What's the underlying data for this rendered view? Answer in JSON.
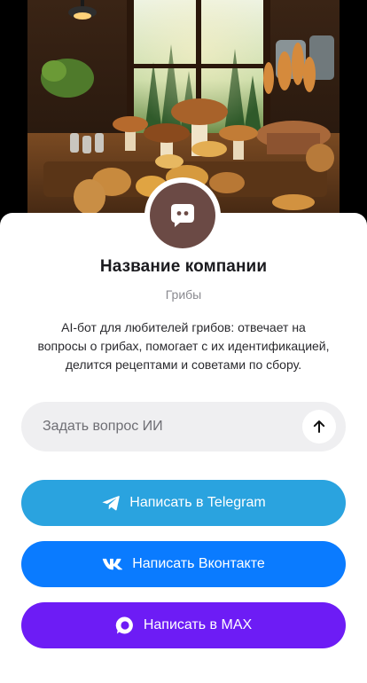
{
  "company": {
    "name": "Название компании",
    "category": "Грибы",
    "description": "AI-бот для любителей грибов: отвечает на вопросы о грибах, помогает с их идентификацией, делится рецептами и советами по сбору.",
    "avatar_icon": "chat-bubble-icon",
    "avatar_color": "#6b4a45"
  },
  "ask": {
    "placeholder": "Задать вопрос ИИ",
    "send_icon": "arrow-up-icon"
  },
  "buttons": {
    "telegram": {
      "label": "Написать в Telegram",
      "icon": "telegram-icon",
      "color": "#2aa3df"
    },
    "vk": {
      "label": "Написать Вконтакте",
      "icon": "vk-icon",
      "color": "#0a7bff"
    },
    "max": {
      "label": "Написать в MAX",
      "icon": "max-icon",
      "color": "#6d1cf5"
    }
  }
}
